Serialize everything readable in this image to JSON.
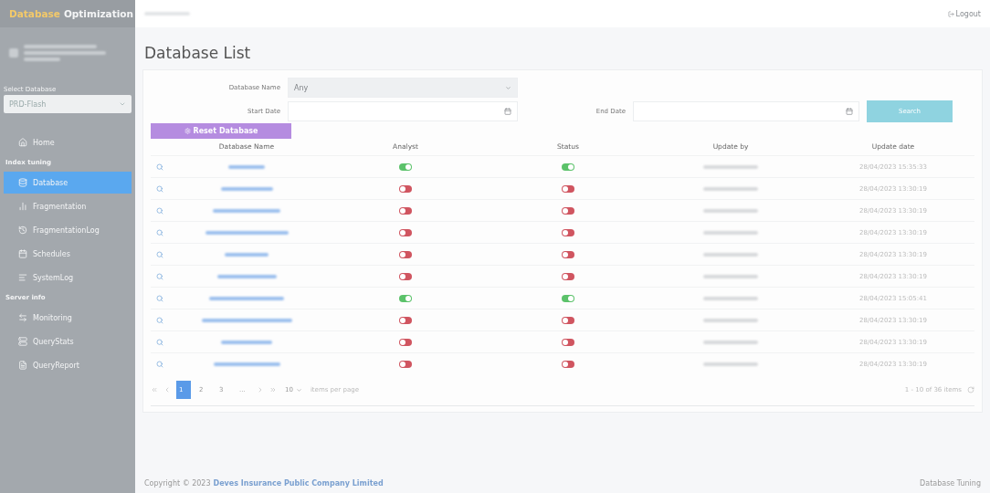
{
  "brand": {
    "highlight": "Database",
    "rest": "Optimization"
  },
  "sidebar": {
    "select_label": "Select Database",
    "select_value": "PRD-Flash",
    "sections": [
      {
        "kind": "item",
        "label": "Home",
        "selected": false
      },
      {
        "kind": "heading",
        "label": "Index tuning"
      },
      {
        "kind": "item",
        "label": "Database",
        "selected": true
      },
      {
        "kind": "item",
        "label": "Fragmentation",
        "selected": false
      },
      {
        "kind": "item",
        "label": "FragmentationLog",
        "selected": false
      },
      {
        "kind": "item",
        "label": "Schedules",
        "selected": false
      },
      {
        "kind": "item",
        "label": "SystemLog",
        "selected": false
      },
      {
        "kind": "heading",
        "label": "Server info"
      },
      {
        "kind": "item",
        "label": "Monitoring",
        "selected": false
      },
      {
        "kind": "item",
        "label": "QueryStats",
        "selected": false
      },
      {
        "kind": "item",
        "label": "QueryReport",
        "selected": false
      }
    ]
  },
  "header": {
    "logout": "Logout"
  },
  "page_title": "Database List",
  "filters": {
    "name_label": "Database Name",
    "name_value": "Any",
    "start_label": "Start Date",
    "end_label": "End Date",
    "search": "Search"
  },
  "reset_button": "Reset Database",
  "table": {
    "columns": [
      "Database Name",
      "Analyst",
      "Status",
      "Update by",
      "Update date"
    ],
    "rows": [
      {
        "analyst": true,
        "status": true,
        "date": "28/04/2023 15:35:33"
      },
      {
        "analyst": false,
        "status": false,
        "date": "28/04/2023 13:30:19"
      },
      {
        "analyst": false,
        "status": false,
        "date": "28/04/2023 13:30:19"
      },
      {
        "analyst": false,
        "status": false,
        "date": "28/04/2023 13:30:19"
      },
      {
        "analyst": false,
        "status": false,
        "date": "28/04/2023 13:30:19"
      },
      {
        "analyst": false,
        "status": false,
        "date": "28/04/2023 13:30:19"
      },
      {
        "analyst": true,
        "status": true,
        "date": "28/04/2023 15:05:41"
      },
      {
        "analyst": false,
        "status": false,
        "date": "28/04/2023 13:30:19"
      },
      {
        "analyst": false,
        "status": false,
        "date": "28/04/2023 13:30:19"
      },
      {
        "analyst": false,
        "status": false,
        "date": "28/04/2023 13:30:19"
      }
    ]
  },
  "pager": {
    "pages": [
      {
        "label": "1",
        "selected": true
      },
      {
        "label": "2",
        "selected": false
      },
      {
        "label": "3",
        "selected": false
      },
      {
        "label": "...",
        "selected": false
      }
    ],
    "page_size": "10",
    "page_size_label": "items per page",
    "summary": "1 - 10 of 36 items"
  },
  "footer": {
    "copyright": "Copyright © 2023",
    "company": "Deves Insurance Public Company Limited",
    "right": "Database Tuning"
  }
}
